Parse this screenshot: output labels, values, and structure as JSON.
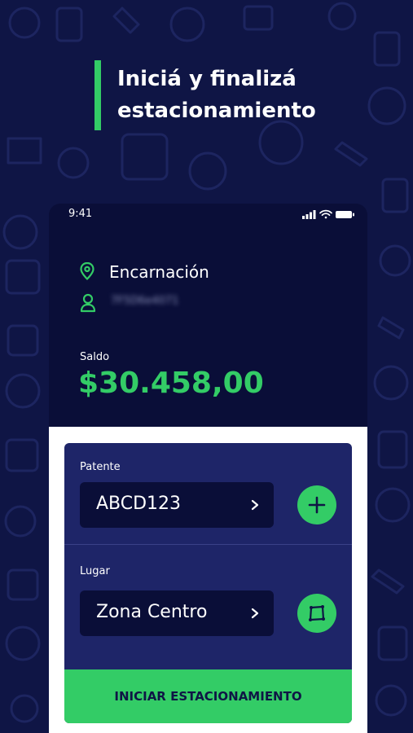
{
  "headline": {
    "line1": "Iniciá y finalizá",
    "line2": "estacionamiento"
  },
  "status_bar": {
    "time": "9:41"
  },
  "account": {
    "location": "Encarnación",
    "user_id": "7F5D6e4071"
  },
  "balance": {
    "label": "Saldo",
    "amount": "$30.458,00"
  },
  "plate": {
    "label": "Patente",
    "value": "ABCD123"
  },
  "place": {
    "label": "Lugar",
    "value": "Zona Centro"
  },
  "start_button": {
    "label": "INICIAR ESTACIONAMIENTO"
  },
  "icons": [
    "location-pin-icon",
    "user-icon",
    "chevron-right-icon",
    "plus-icon",
    "map-area-icon",
    "signal-icon",
    "wifi-icon",
    "battery-icon"
  ],
  "colors": {
    "background": "#0f1545",
    "phone": "#0a0e38",
    "card": "#1e2568",
    "accent": "#33cc66"
  }
}
